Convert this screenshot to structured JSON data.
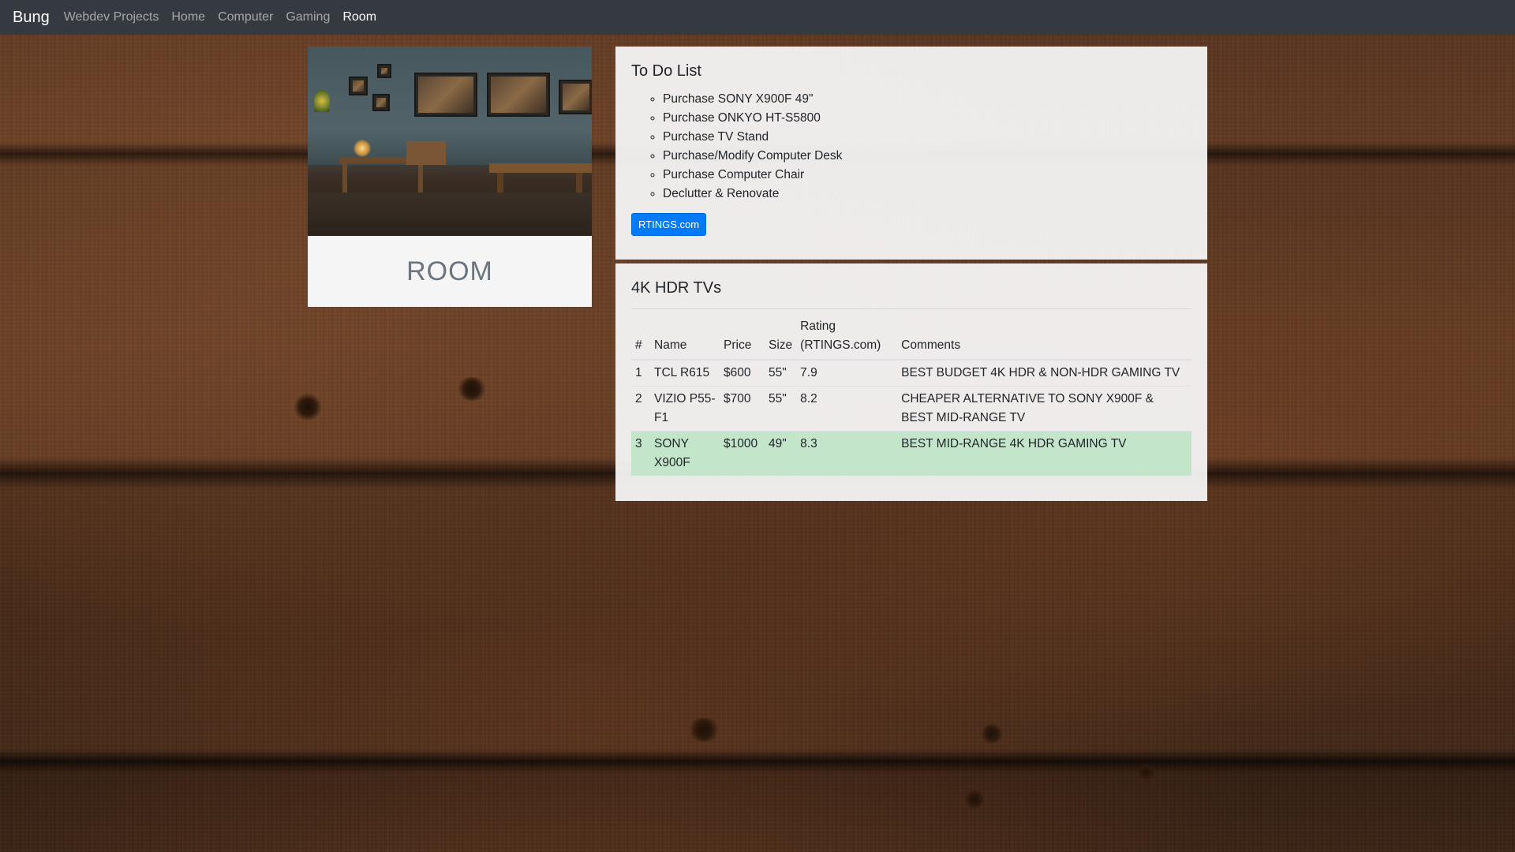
{
  "navbar": {
    "brand": "Bung",
    "links": [
      {
        "label": "Webdev Projects"
      },
      {
        "label": "Home"
      },
      {
        "label": "Computer"
      },
      {
        "label": "Gaming"
      },
      {
        "label": "Room"
      }
    ],
    "active_label": "Room"
  },
  "room_card": {
    "title": "ROOM"
  },
  "todo": {
    "title": "To Do List",
    "items": [
      "Purchase SONY X900F 49\"",
      "Purchase ONKYO HT-S5800",
      "Purchase TV Stand",
      "Purchase/Modify Computer Desk",
      "Purchase Computer Chair",
      "Declutter & Renovate"
    ],
    "button_label": "RTINGS.com"
  },
  "tvs": {
    "title": "4K HDR TVs",
    "headers": {
      "num": "#",
      "name": "Name",
      "price": "Price",
      "size": "Size",
      "rating": "Rating (RTINGS.com)",
      "comments": "Comments"
    },
    "rows": [
      {
        "num": "1",
        "name": "TCL R615",
        "price": "$600",
        "size": "55\"",
        "rating": "7.9",
        "comments": "BEST BUDGET 4K HDR & NON-HDR GAMING TV"
      },
      {
        "num": "2",
        "name": "VIZIO P55-F1",
        "price": "$700",
        "size": "55\"",
        "rating": "8.2",
        "comments": "CHEAPER ALTERNATIVE TO SONY X900F & BEST MID-RANGE TV"
      },
      {
        "num": "3",
        "name": "SONY X900F",
        "price": "$1000",
        "size": "49\"",
        "rating": "8.3",
        "comments": "BEST MID-RANGE 4K HDR GAMING TV"
      }
    ],
    "highlight_color": "#c3e6cb"
  },
  "colors": {
    "navbar_bg": "#343a40",
    "button_bg": "#007bff"
  }
}
